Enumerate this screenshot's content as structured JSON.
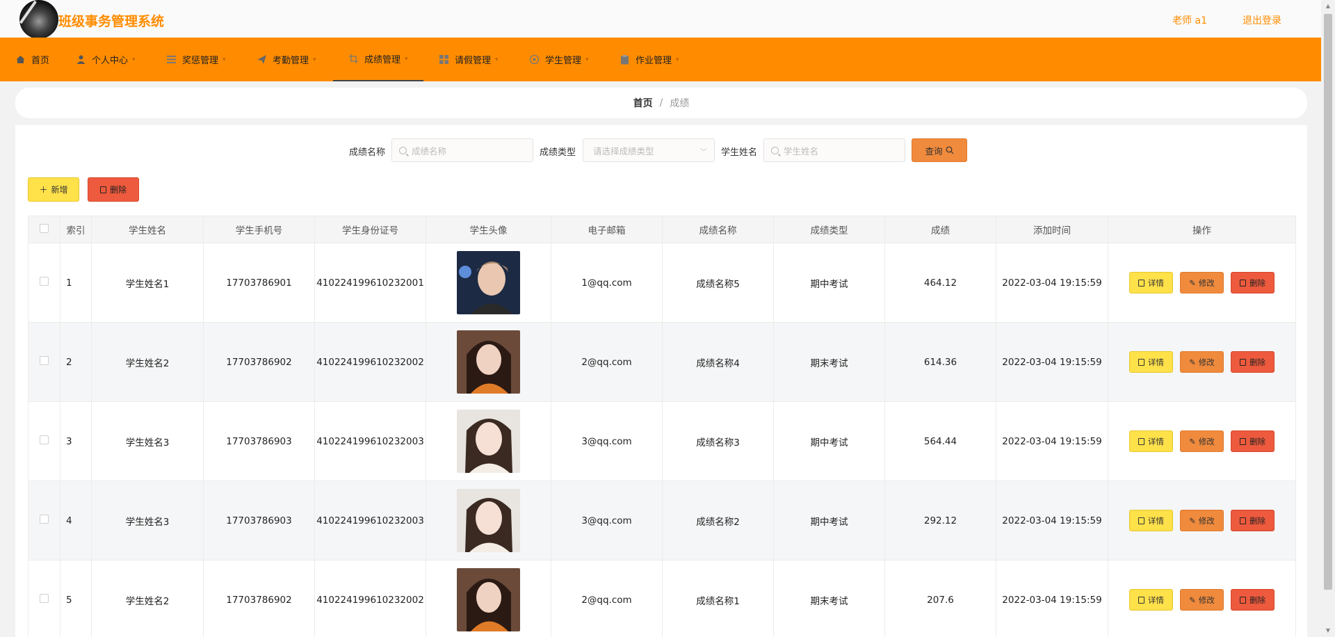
{
  "app": {
    "title": "班级事务管理系统"
  },
  "header": {
    "user": "老师 a1",
    "logout": "退出登录"
  },
  "nav": {
    "items": [
      {
        "label": "首页",
        "icon": "home-icon"
      },
      {
        "label": "个人中心",
        "icon": "user-icon"
      },
      {
        "label": "奖惩管理",
        "icon": "list-icon"
      },
      {
        "label": "考勤管理",
        "icon": "send-icon"
      },
      {
        "label": "成绩管理",
        "icon": "crop-icon",
        "active": true
      },
      {
        "label": "请假管理",
        "icon": "grid-icon"
      },
      {
        "label": "学生管理",
        "icon": "circle-icon"
      },
      {
        "label": "作业管理",
        "icon": "clipboard-icon"
      }
    ]
  },
  "breadcrumb": {
    "home": "首页",
    "separator": "/",
    "current": "成绩"
  },
  "search": {
    "name_label": "成绩名称",
    "name_placeholder": "成绩名称",
    "type_label": "成绩类型",
    "type_placeholder": "请选择成绩类型",
    "student_label": "学生姓名",
    "student_placeholder": "学生姓名",
    "query_label": "查询"
  },
  "toolbar": {
    "add_label": "新增",
    "delete_label": "删除"
  },
  "table": {
    "headers": [
      "索引",
      "学生姓名",
      "学生手机号",
      "学生身份证号",
      "学生头像",
      "电子邮箱",
      "成绩名称",
      "成绩类型",
      "成绩",
      "添加时间",
      "操作"
    ],
    "actions": {
      "detail": "详情",
      "edit": "修改",
      "delete": "删除"
    },
    "rows": [
      {
        "index": "1",
        "name": "学生姓名1",
        "phone": "17703786901",
        "id_card": "410224199610232001",
        "email": "1@qq.com",
        "score_name": "成绩名称5",
        "score_type": "期中考试",
        "score": "464.12",
        "added": "2022-03-04 19:15:59"
      },
      {
        "index": "2",
        "name": "学生姓名2",
        "phone": "17703786902",
        "id_card": "410224199610232002",
        "email": "2@qq.com",
        "score_name": "成绩名称4",
        "score_type": "期末考试",
        "score": "614.36",
        "added": "2022-03-04 19:15:59"
      },
      {
        "index": "3",
        "name": "学生姓名3",
        "phone": "17703786903",
        "id_card": "410224199610232003",
        "email": "3@qq.com",
        "score_name": "成绩名称3",
        "score_type": "期中考试",
        "score": "564.44",
        "added": "2022-03-04 19:15:59"
      },
      {
        "index": "4",
        "name": "学生姓名3",
        "phone": "17703786903",
        "id_card": "410224199610232003",
        "email": "3@qq.com",
        "score_name": "成绩名称2",
        "score_type": "期中考试",
        "score": "292.12",
        "added": "2022-03-04 19:15:59"
      },
      {
        "index": "5",
        "name": "学生姓名2",
        "phone": "17703786902",
        "id_card": "410224199610232002",
        "email": "2@qq.com",
        "score_name": "成绩名称1",
        "score_type": "期末考试",
        "score": "207.6",
        "added": "2022-03-04 19:15:59"
      }
    ]
  },
  "colors": {
    "brand": "#ff8c00",
    "detail": "#ffe14a",
    "edit": "#f08a3c",
    "delete": "#ee5a3d"
  }
}
